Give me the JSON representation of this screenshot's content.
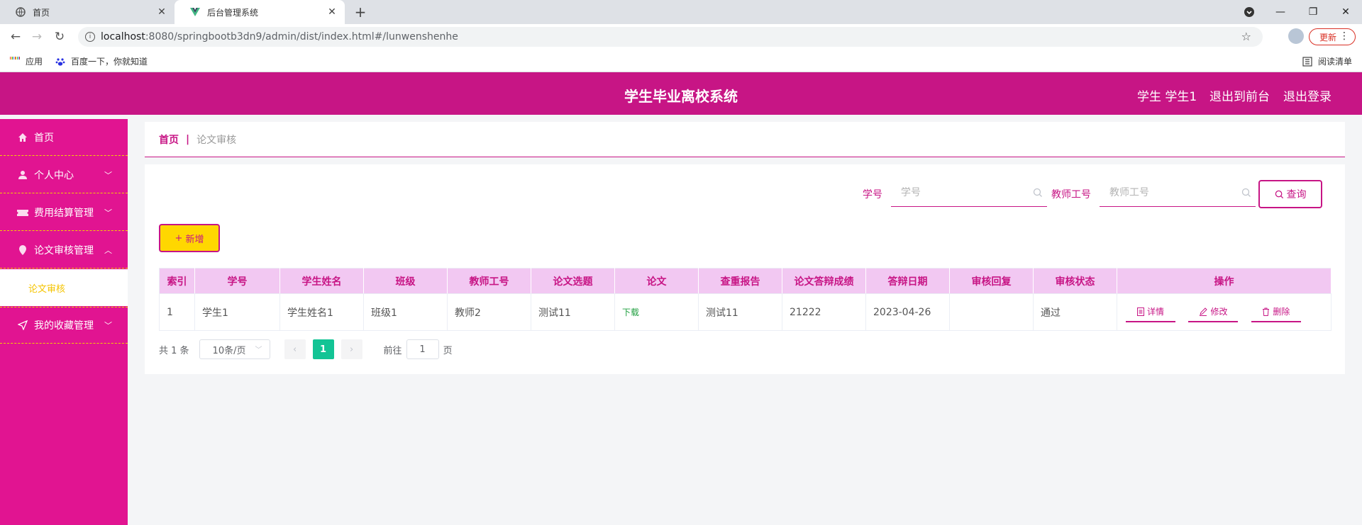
{
  "browser": {
    "tabs": [
      {
        "title": "首页"
      },
      {
        "title": "后台管理系统"
      }
    ],
    "url_host": "localhost",
    "url_path": ":8080/springbootb3dn9/admin/dist/index.html#/lunwenshenhe",
    "update_label": "更新",
    "bookmarks": [
      {
        "label": "应用"
      },
      {
        "label": "百度一下，你就知道"
      },
      {
        "label": "阅读清单"
      }
    ]
  },
  "header": {
    "title": "学生毕业离校系统",
    "user": "学生 学生1",
    "to_front": "退出到前台",
    "logout": "退出登录"
  },
  "sidebar": {
    "items": [
      {
        "label": "首页",
        "icon": "home-icon"
      },
      {
        "label": "个人中心",
        "icon": "user-icon"
      },
      {
        "label": "费用结算管理",
        "icon": "ticket-icon"
      },
      {
        "label": "论文审核管理",
        "icon": "pin-icon"
      },
      {
        "label": "我的收藏管理",
        "icon": "send-icon"
      }
    ],
    "submenu_label": "论文审核"
  },
  "breadcrumb": {
    "home": "首页",
    "separator": "|",
    "current": "论文审核"
  },
  "search": {
    "student_no_label": "学号",
    "student_no_placeholder": "学号",
    "teacher_no_label": "教师工号",
    "teacher_no_placeholder": "教师工号",
    "query_label": "查询"
  },
  "toolbar": {
    "add_label": "新增"
  },
  "table": {
    "columns": [
      "索引",
      "学号",
      "学生姓名",
      "班级",
      "教师工号",
      "论文选题",
      "论文",
      "查重报告",
      "论文答辩成绩",
      "答辩日期",
      "审核回复",
      "审核状态",
      "操作"
    ],
    "rows": [
      {
        "index": "1",
        "student_no": "学生1",
        "student_name": "学生姓名1",
        "class": "班级1",
        "teacher_no": "教师2",
        "topic": "测试11",
        "paper": "下载",
        "report": "测试11",
        "score": "21222",
        "date": "2023-04-26",
        "reply": "",
        "status": "通过"
      }
    ],
    "actions": {
      "detail": "详情",
      "edit": "修改",
      "delete": "删除"
    }
  },
  "pagination": {
    "total_text": "共 1 条",
    "page_size": "10条/页",
    "current_page": "1",
    "goto_prefix": "前往",
    "goto_value": "1",
    "goto_suffix": "页"
  },
  "colors": {
    "brand": "#c71585",
    "sidebar": "#e11491",
    "accent_yellow": "#ffd700",
    "page_active": "#13c495"
  }
}
